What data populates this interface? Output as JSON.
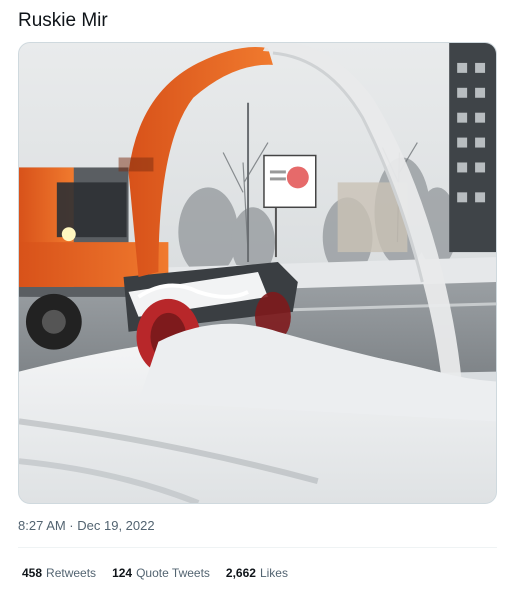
{
  "tweet": {
    "text": "Ruskie Mir",
    "timestamp": "8:27 AM · Dec 19, 2022"
  },
  "stats": {
    "retweets_count": "458",
    "retweets_label": "Retweets",
    "quotes_count": "124",
    "quotes_label": "Quote Tweets",
    "likes_count": "2,662",
    "likes_label": "Likes"
  },
  "colors": {
    "text_primary": "#0f1419",
    "text_secondary": "#536471",
    "border": "#cfd9de",
    "divider": "#eff3f4",
    "snowplow_orange": "#e8641e"
  }
}
